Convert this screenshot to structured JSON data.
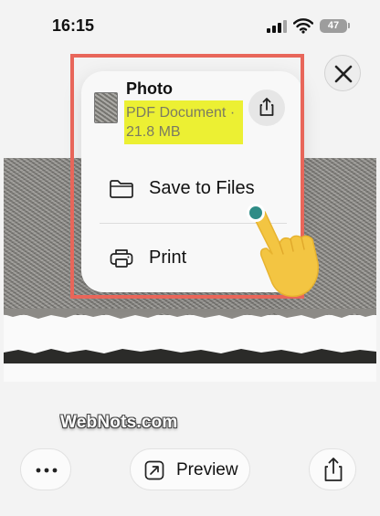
{
  "status_bar": {
    "time": "16:15",
    "battery": "47",
    "icons": [
      "signal-icon",
      "wifi-icon",
      "battery-icon"
    ]
  },
  "close_button": {
    "icon": "close-icon"
  },
  "menu": {
    "title": "Photo",
    "subtitle": "PDF Document · 21.8 MB",
    "share_icon": "share-icon",
    "items": [
      {
        "label": "Save to Files",
        "icon": "folder-icon"
      },
      {
        "label": "Print",
        "icon": "printer-icon"
      }
    ]
  },
  "annotation": {
    "highlight_color": "#e8665a",
    "marker_color": "#ecf033",
    "tap_color": "#2f8c86",
    "hand_color": "#f3c542",
    "hand_icon": "pointing-hand-icon"
  },
  "watermark": {
    "text": "WebNots.com"
  },
  "toolbar": {
    "more_icon": "more-icon",
    "preview_label": "Preview",
    "preview_icon": "preview-arrow-icon",
    "share_icon": "share-icon"
  }
}
